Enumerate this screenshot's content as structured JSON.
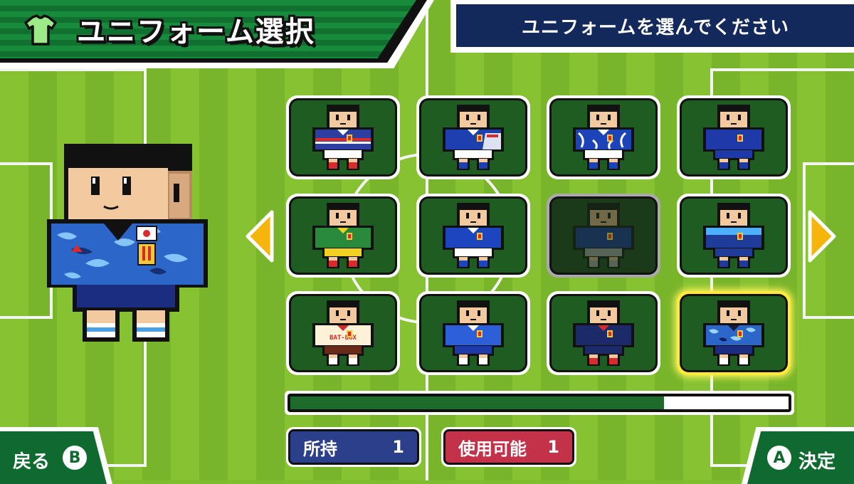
{
  "header": {
    "title": "ユニフォーム選択",
    "title_icon": "shirt-icon",
    "instruction": "ユニフォームを選んでください"
  },
  "grid": {
    "uniforms": [
      {
        "shirt": "#2c3fa0",
        "collar": "#ffffff",
        "shorts": "#ffffff",
        "socks": "#d82c2c",
        "skin": "#f3c9a0",
        "pattern": "stripe-v"
      },
      {
        "shirt": "#1d3fb0",
        "collar": "#ffffff",
        "shorts": "#ffffff",
        "socks": "#1d3fb0",
        "skin": "#f3c9a0",
        "pattern": "side-white"
      },
      {
        "shirt": "#1c43b8",
        "collar": "#ffffff",
        "shorts": "#ffffff",
        "socks": "#1c43b8",
        "skin": "#f3c9a0",
        "pattern": "feather"
      },
      {
        "shirt": "#1e3aa8",
        "collar": "#1e3aa8",
        "shorts": "#1e3aa8",
        "socks": "#1e3aa8",
        "skin": "#f3c9a0",
        "pattern": "plain"
      },
      {
        "shirt": "#2a8a3c",
        "collar": "#f0d020",
        "shorts": "#f0d020",
        "socks": "#d82c2c",
        "skin": "#f3c9a0",
        "pattern": "plain"
      },
      {
        "shirt": "#1e45c0",
        "collar": "#ffffff",
        "shorts": "#ffffff",
        "socks": "#1e45c0",
        "skin": "#f3c9a0",
        "pattern": "plain"
      },
      {
        "shirt": "#1a2d80",
        "collar": "#1a2d80",
        "shorts": "#888888",
        "socks": "#888888",
        "skin": "#b8906c",
        "pattern": "plain"
      },
      {
        "shirt": "#1f3d98",
        "collar": "#4db0ff",
        "shorts": "#1f3d98",
        "socks": "#1f3d98",
        "skin": "#f3c9a0",
        "pattern": "gradient"
      },
      {
        "shirt": "#fdf1d8",
        "collar": "#d22a2a",
        "shorts": "#6a2a1a",
        "socks": "#ffffff",
        "skin": "#f3c9a0",
        "pattern": "text",
        "text": "BAT-BOX"
      },
      {
        "shirt": "#2d5fd8",
        "collar": "#ffffff",
        "shorts": "#1e3aa8",
        "socks": "#ffffff",
        "skin": "#f3c9a0",
        "pattern": "plain"
      },
      {
        "shirt": "#1c2a6a",
        "collar": "#d82c2c",
        "shorts": "#1c2a6a",
        "socks": "#d82c2c",
        "skin": "#f3c9a0",
        "pattern": "plain"
      },
      {
        "shirt": "#2b66c8",
        "collar": "#1a1a3a",
        "shorts": "#1a2d80",
        "socks": "#ffffff",
        "skin": "#f3c9a0",
        "pattern": "camo"
      }
    ],
    "dimmed_index": 6,
    "selected_index": 11
  },
  "progress": {
    "fraction": 0.75
  },
  "stats": {
    "owned_label": "所持",
    "owned_value": "1",
    "usable_label": "使用可能",
    "usable_value": "1"
  },
  "buttons": {
    "back_label": "戻る",
    "back_key": "B",
    "confirm_label": "決定",
    "confirm_key": "A"
  },
  "colors": {
    "owned_badge": "#2b3f8a",
    "usable_badge": "#c4324a",
    "arrow": "#f5b50a"
  }
}
